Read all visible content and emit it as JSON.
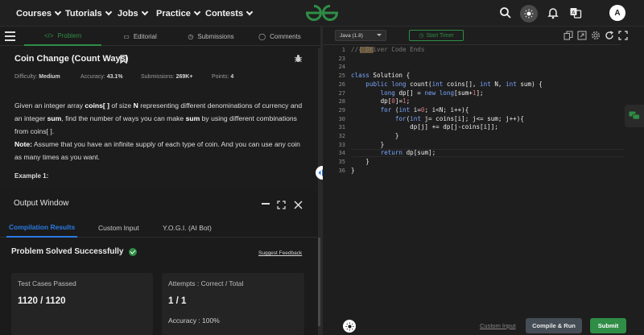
{
  "nav": {
    "items": [
      "Courses",
      "Tutorials",
      "Jobs",
      "Practice",
      "Contests"
    ],
    "avatar_letter": "A"
  },
  "problem_tabs": [
    {
      "label": "Problem",
      "icon": "code-icon",
      "active": true
    },
    {
      "label": "Editorial",
      "icon": "book-icon",
      "active": false
    },
    {
      "label": "Submissions",
      "icon": "clock-icon",
      "active": false
    },
    {
      "label": "Comments",
      "icon": "comment-icon",
      "active": false
    }
  ],
  "problem": {
    "title": "Coin Change (Count Ways)",
    "difficulty_label": "Difficulty:",
    "difficulty": "Medium",
    "accuracy_label": "Accuracy:",
    "accuracy": "43.1%",
    "submissions_label": "Submissions:",
    "submissions": "269K+",
    "points_label": "Points:",
    "points": "4",
    "desc_1": "Given an integer array ",
    "desc_coins": "coins[ ]",
    "desc_2": " of size ",
    "desc_N": "N",
    "desc_3": " representing different denominations of currency and an integer ",
    "desc_sum": "sum",
    "desc_4": ", find the number of ways you can make ",
    "desc_sum2": "sum",
    "desc_5": " by using different combinations from coins[ ].",
    "note_label": "Note:",
    "note_text": " Assume that you have an infinite supply of each type of coin. And you can use any coin as many times as you want.",
    "example_heading": "Example 1:"
  },
  "output_window": {
    "title": "Output Window",
    "tabs": [
      "Compilation Results",
      "Custom Input",
      "Y.O.G.I. (AI Bot)"
    ],
    "status": "Problem Solved Successfully",
    "suggest_feedback": "Suggest Feedback",
    "cards": [
      {
        "label": "Test Cases Passed",
        "value": "1120 / 1120"
      },
      {
        "label": "Attempts : Correct / Total",
        "value": "1 / 1",
        "extra": "Accuracy : 100%"
      }
    ]
  },
  "editor": {
    "language": "Java (1.8)",
    "timer_label": "Start Timer",
    "lines": [
      {
        "n": "1",
        "html": "<span class='cm'>//{ Driver Code Ends</span>"
      },
      {
        "n": "23",
        "html": ""
      },
      {
        "n": "24",
        "html": ""
      },
      {
        "n": "25",
        "html": "<span class='kw'>class</span> Solution {"
      },
      {
        "n": "26",
        "html": "    <span class='kw'>public long</span> count(<span class='kw'>int</span> coins[], <span class='kw'>int</span> N, <span class='kw'>int</span> sum) {"
      },
      {
        "n": "27",
        "html": "        <span class='kw'>long</span> dp[] = <span class='kw'>new long</span>[sum+<span class='num'>1</span>];"
      },
      {
        "n": "28",
        "html": "        dp[<span class='num'>0</span>]=<span class='num'>1</span>;"
      },
      {
        "n": "29",
        "html": "        <span class='kw'>for</span> (<span class='kw'>int</span> i=<span class='num'>0</span>; i&lt;N; i++){"
      },
      {
        "n": "30",
        "html": "            <span class='kw'>for</span>(<span class='kw'>int</span> j= coins[i]; j&lt;= sum; j++){"
      },
      {
        "n": "31",
        "html": "                dp[j] += dp[j-coins[i]];"
      },
      {
        "n": "32",
        "html": "            }"
      },
      {
        "n": "33",
        "html": "        }"
      },
      {
        "n": "34",
        "html": "        <span class='kw'>return</span> dp[sum];"
      },
      {
        "n": "35",
        "html": "    }"
      },
      {
        "n": "36",
        "html": "}"
      }
    ],
    "custom_input": "Custom Input",
    "compile_run": "Compile & Run",
    "submit": "Submit"
  }
}
